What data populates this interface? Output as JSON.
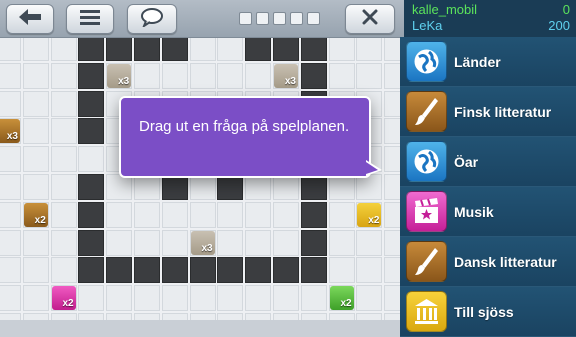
{
  "scores": [
    {
      "name": "kalle_mobil",
      "score": "0"
    },
    {
      "name": "LeKa",
      "score": "200"
    }
  ],
  "prompt": "Drag ut en fråga på spelplanen.",
  "categories": [
    {
      "label": "Länder",
      "icon": "globe-icon"
    },
    {
      "label": "Finsk litteratur",
      "icon": "paintbrush-icon"
    },
    {
      "label": "Öar",
      "icon": "globe-icon"
    },
    {
      "label": "Musik",
      "icon": "clapperboard-icon"
    },
    {
      "label": "Dansk litteratur",
      "icon": "paintbrush-icon"
    },
    {
      "label": "Till sjöss",
      "icon": "temple-icon"
    }
  ],
  "board_tiles": [
    {
      "label": "x3",
      "color": "#a59b88"
    },
    {
      "label": "x3",
      "color": "#a59b88"
    },
    {
      "label": "x3",
      "color": "#8a5a1c"
    },
    {
      "label": "x2",
      "color": "#8a5a1c"
    },
    {
      "label": "x2",
      "color": "#d8a412"
    },
    {
      "label": "x3",
      "color": "#a59b88"
    },
    {
      "label": "x2",
      "color": "#c21d8d"
    },
    {
      "label": "x2",
      "color": "#3ea029"
    }
  ],
  "progress_dots": 5
}
